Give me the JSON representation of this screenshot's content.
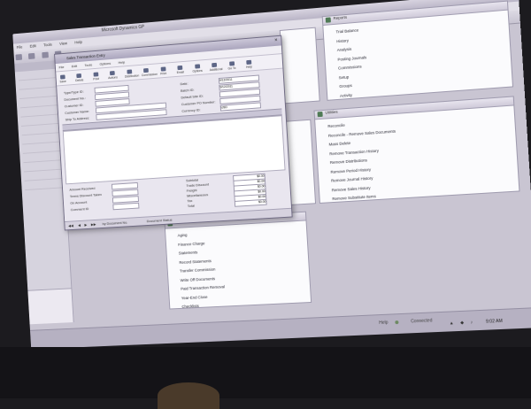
{
  "app": {
    "window_title": "Microsoft Dynamics GP",
    "menu": [
      "File",
      "Edit",
      "Tools",
      "View",
      "Help"
    ],
    "status": {
      "help": "Help",
      "connected": "Connected",
      "time": "9:02 AM"
    }
  },
  "dialog": {
    "title": "Sales Transaction Entry",
    "menu": [
      "File",
      "Edit",
      "Tools",
      "Options",
      "Help"
    ],
    "buttons": [
      "Save",
      "Delete",
      "Post",
      "Actions",
      "Distribution",
      "Commission",
      "Print",
      "Email",
      "Options",
      "Additional",
      "Go To",
      "Help"
    ],
    "labels": [
      "Type/Type ID:",
      "Document No.:",
      "Customer ID:",
      "Customer Name:",
      "Ship To Address:",
      "Date:",
      "Batch ID:",
      "Default Site ID:",
      "Customer PO Number:",
      "Currency ID:",
      "Subtotal",
      "Trade Discount",
      "Freight",
      "Miscellaneous",
      "Tax",
      "Total",
      "Amount Received",
      "Terms Discount Taken",
      "On Account",
      "Comment ID"
    ],
    "values": {
      "date": "9/12/2011",
      "batch": "9/12/2011",
      "currency": "USD",
      "amount": "$0.00"
    },
    "nav": {
      "sort": "by Document No.",
      "status": "Document Status"
    }
  },
  "panels": {
    "reports": {
      "title": "Reports",
      "items": [
        "Trial Balance",
        "History",
        "Analysis",
        "Posting Journals",
        "Commissions",
        "Setup",
        "Groups",
        "Activity"
      ]
    },
    "utilities": {
      "title": "Utilities",
      "items": [
        "Reconcile",
        "Reconcile - Remove Sales Documents",
        "Mass Delete",
        "Remove Transaction History",
        "Remove Distributions",
        "Remove Period History",
        "Remove Journal History",
        "Remove Sales History",
        "Remove Substitute Items"
      ]
    },
    "routines": {
      "title": "Routines",
      "items": [
        "Aging",
        "Finance Charge",
        "Statements",
        "Record Statements",
        "Transfer Commission",
        "Write Off Documents",
        "Paid Transaction Removal",
        "Year-End Close",
        "Checklists"
      ]
    }
  },
  "colors": {
    "panel_icon": "#4f7a55",
    "chrome": "#c9c5d2"
  }
}
